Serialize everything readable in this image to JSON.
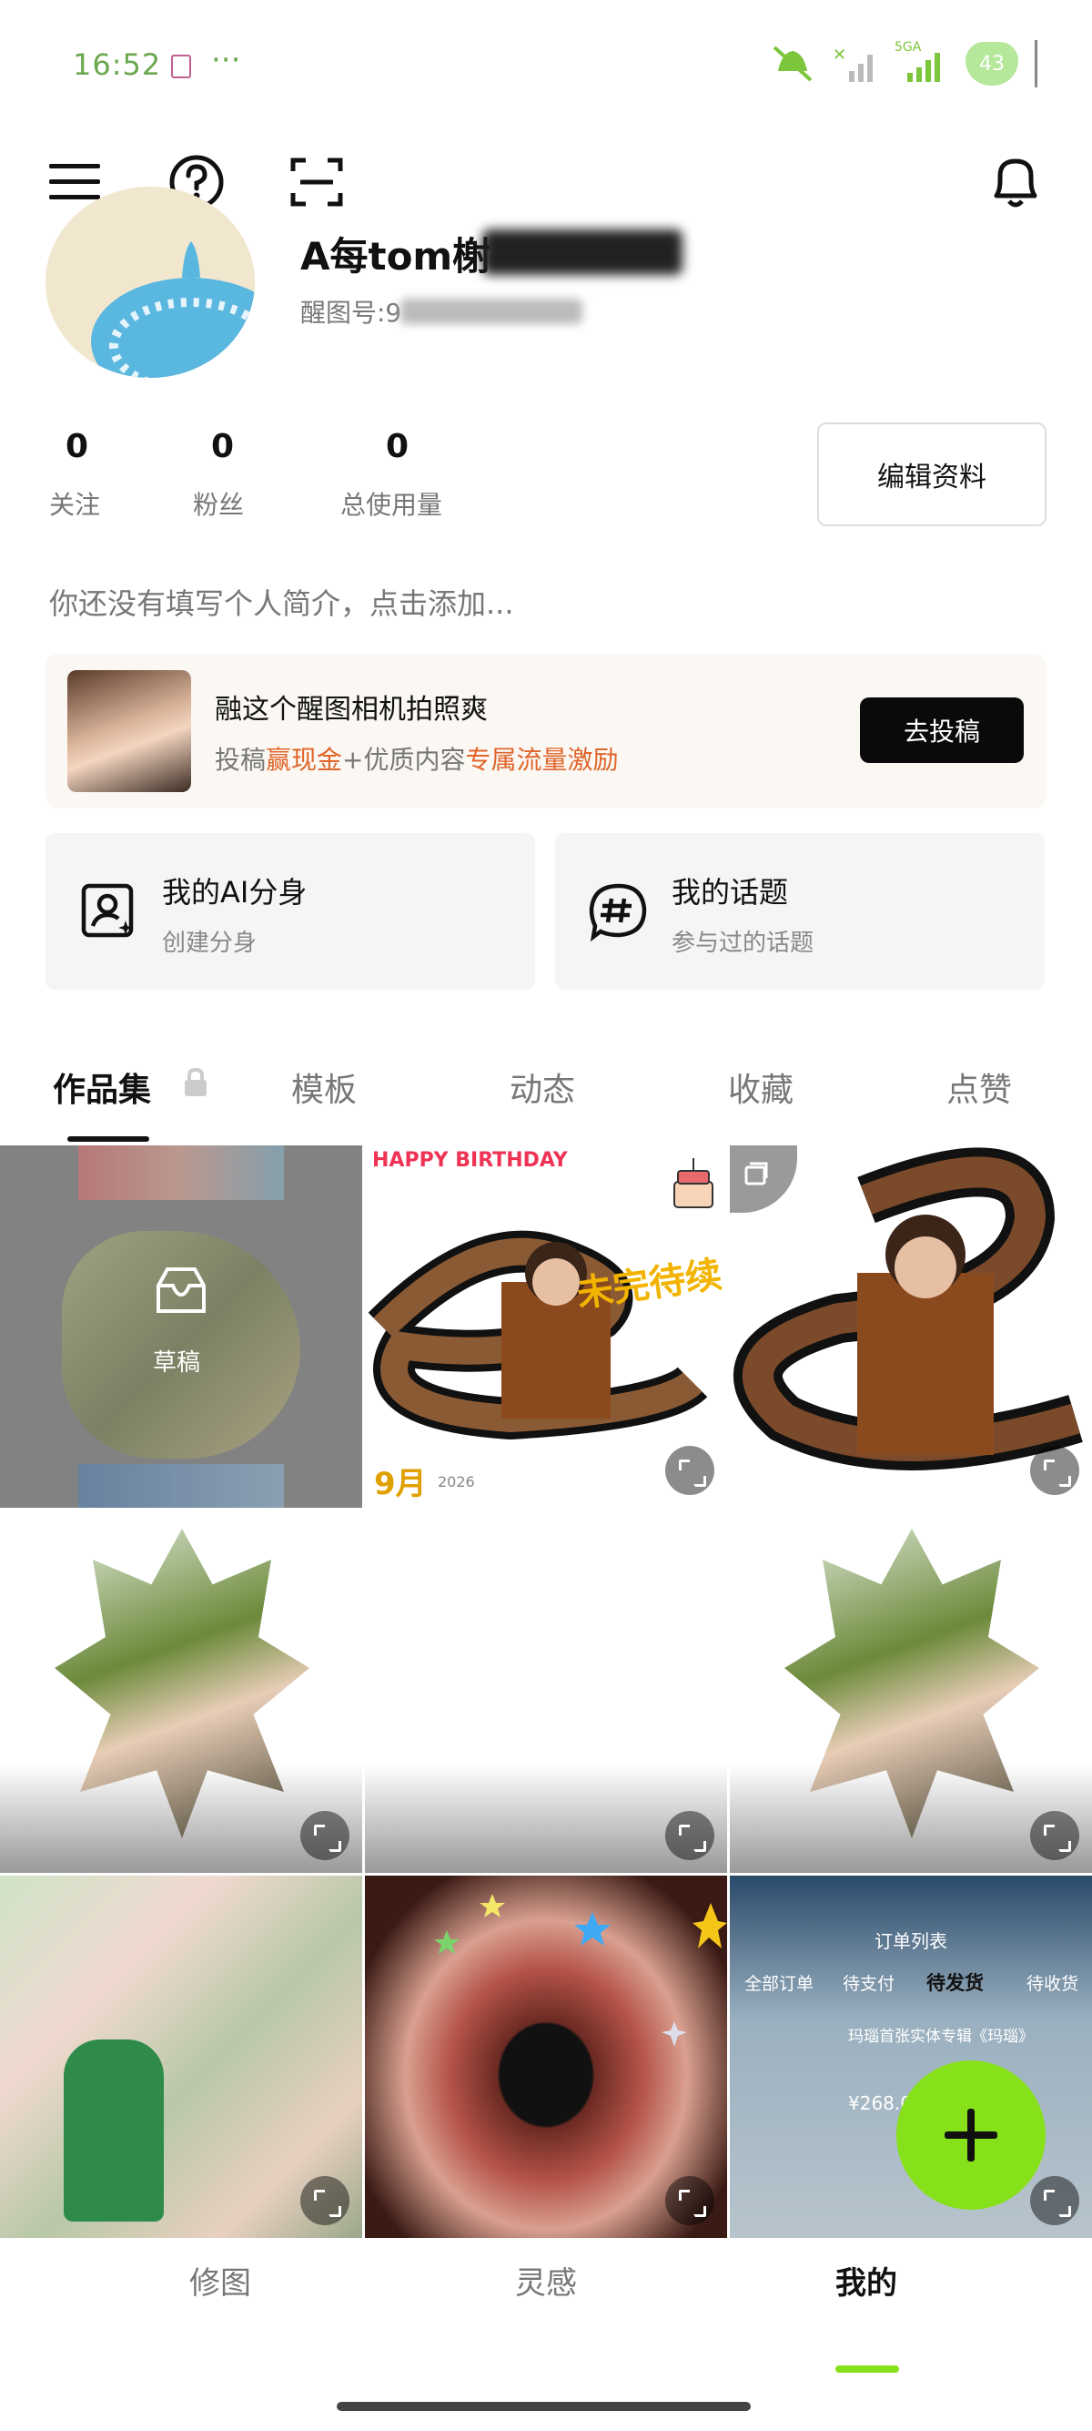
{
  "status_bar": {
    "time": "16:52",
    "dots": "···",
    "network": "5GA",
    "battery": "43",
    "icons": [
      "sim-card-icon",
      "mute-icon",
      "wifi-off-icon",
      "signal-icon",
      "battery-heart-icon"
    ]
  },
  "header": {
    "icons": [
      "menu-icon",
      "help-icon",
      "scan-icon",
      "bell-icon"
    ]
  },
  "profile": {
    "name": "A每tom榭",
    "id_label": "醒图号:9",
    "stats": [
      {
        "value": "0",
        "label": "关注"
      },
      {
        "value": "0",
        "label": "粉丝"
      },
      {
        "value": "0",
        "label": "总使用量"
      }
    ],
    "edit_button": "编辑资料",
    "bio": "你还没有填写个人简介，点击添加..."
  },
  "promo": {
    "title": "融这个醒图相机拍照爽",
    "subtitle_prefix": "投稿",
    "subtitle_hl1": "赢现金",
    "subtitle_mid": "+优质内容",
    "subtitle_hl2": "专属流量激励",
    "button": "去投稿"
  },
  "cards": [
    {
      "title": "我的AI分身",
      "subtitle": "创建分身",
      "icon": "ai-avatar-icon"
    },
    {
      "title": "我的话题",
      "subtitle": "参与过的话题",
      "icon": "hashtag-icon"
    }
  ],
  "tabs": [
    "作品集",
    "模板",
    "动态",
    "收藏",
    "点赞"
  ],
  "active_tab": "作品集",
  "grid": {
    "draft_label": "草稿",
    "birthday_title": "HAPPY BIRTHDAY",
    "birthday_sub": "未完待续",
    "calendar_month": "9月",
    "calendar_year": "2026",
    "order_header": "订单列表",
    "order_tabs": [
      "全部订单",
      "待支付",
      "待发货",
      "待收货"
    ],
    "order_product": "玛瑙首张实体专辑《玛瑙》",
    "order_price": "¥268.0"
  },
  "bottom_nav": [
    "修图",
    "灵感",
    "我的"
  ],
  "active_nav": "我的",
  "colors": {
    "accent_green": "#86e01a",
    "promo_highlight": "#e0652a",
    "status_green": "#6aa84f"
  }
}
